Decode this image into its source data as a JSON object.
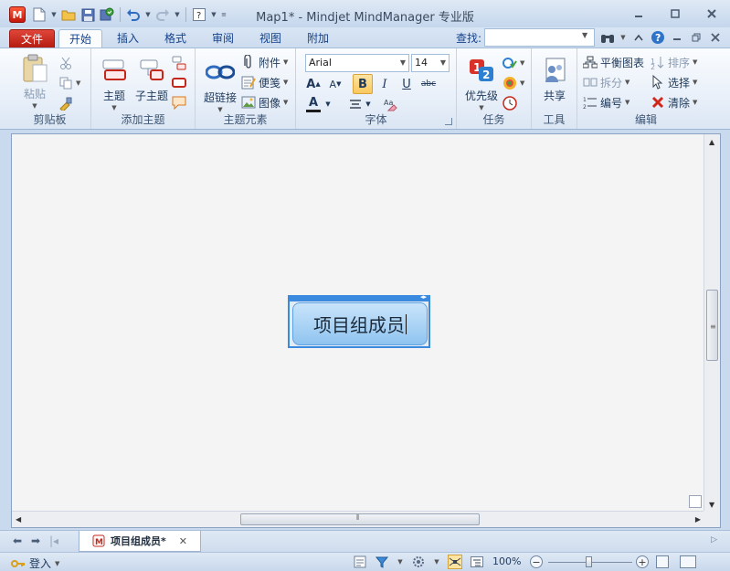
{
  "window": {
    "title": "Map1* - Mindjet MindManager 专业版",
    "logo_letter": "M"
  },
  "ribbon_tabs": [
    "文件",
    "开始",
    "插入",
    "格式",
    "审阅",
    "视图",
    "附加"
  ],
  "find": {
    "label": "查找:",
    "value": ""
  },
  "groups": {
    "clipboard": {
      "label": "剪贴板",
      "paste": "粘贴"
    },
    "add_topic": {
      "label": "添加主题",
      "topic": "主题",
      "subtopic": "子主题"
    },
    "topic_elements": {
      "label": "主题元素",
      "hyperlink": "超链接",
      "attachment": "附件",
      "notes": "便笺",
      "image": "图像"
    },
    "font": {
      "label": "字体",
      "font_name": "Arial",
      "font_size": "14",
      "bold": "B",
      "italic": "I",
      "underline": "U",
      "strike": "abc",
      "grow": "A",
      "shrink": "A",
      "color": "A"
    },
    "task": {
      "label": "任务",
      "priority": "优先级"
    },
    "tools": {
      "label": "工具",
      "share": "共享"
    },
    "edit": {
      "label": "编辑",
      "balance": "平衡图表",
      "sort": "排序",
      "split": "拆分",
      "select": "选择",
      "numbering": "编号",
      "clear": "清除"
    }
  },
  "canvas": {
    "central_topic": "项目组成员"
  },
  "document_tab": {
    "label": "项目组成员*"
  },
  "status": {
    "login": "登入",
    "zoom": "100%"
  },
  "colors": {
    "file_tab": "#c4281b",
    "topic_fill": "#a8d3f5",
    "selection": "#3a8be0"
  }
}
